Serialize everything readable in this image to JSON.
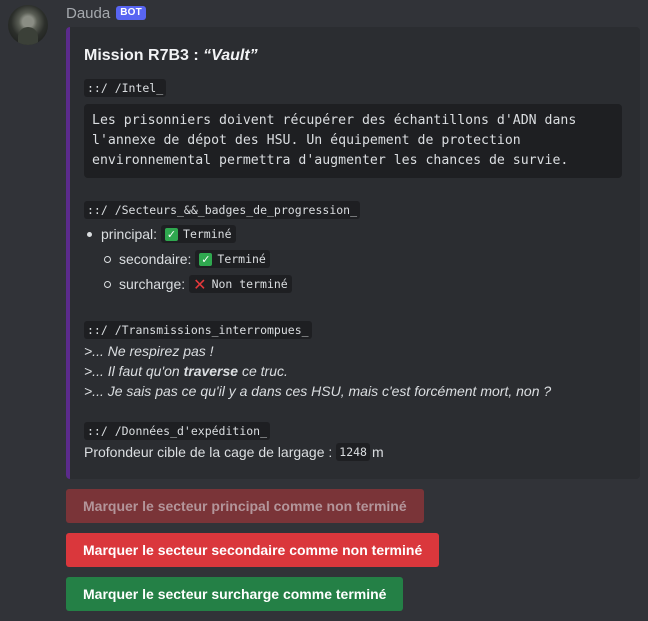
{
  "message": {
    "username": "Dauda",
    "badge": "BOT"
  },
  "embed": {
    "accent_color": "#5b2b8c",
    "title_prefix": "Mission R7B3 : ",
    "title_name": "“Vault”",
    "intel_label": "::/ /Intel_",
    "intel_lines": [
      "Les prisonniers doivent récupérer des échantillons d'ADN dans",
      "l'annexe de dépot des HSU. Un équipement de protection",
      "environnemental permettra d'augmenter les chances de survie."
    ],
    "sectors_label": "::/ /Secteurs_&&_badges_de_progression_",
    "sectors": [
      {
        "name": "principal:",
        "status_icon": "check-icon",
        "status": "Terminé"
      },
      {
        "name": "secondaire:",
        "status_icon": "check-icon",
        "status": "Terminé"
      },
      {
        "name": "surcharge:",
        "status_icon": "cross-icon",
        "status": "Non terminé"
      }
    ],
    "transmissions_label": "::/ /Transmissions_interrompues_",
    "transmissions": {
      "line1": ">... Ne respirez pas !",
      "line2_before": ">... Il faut qu'on ",
      "line2_bold": "traverse",
      "line2_after": " ce truc.",
      "line3": ">... Je sais pas ce qu'il y a dans ces HSU, mais c'est forcément mort, non ?"
    },
    "expedition_label": "::/ /Données_d'expédition_",
    "depth_label": "Profondeur cible de la cage de largage :",
    "depth_value": "1248",
    "depth_unit": "m"
  },
  "buttons": {
    "primary": "Marquer le secteur principal comme non terminé",
    "secondary": "Marquer le secteur secondaire comme non terminé",
    "overload": "Marquer le secteur surcharge comme terminé"
  },
  "colors": {
    "background": "#313338",
    "embed_bg": "#2b2d31",
    "danger": "#da373c",
    "success": "#248046",
    "disabled": "#7a3438"
  }
}
